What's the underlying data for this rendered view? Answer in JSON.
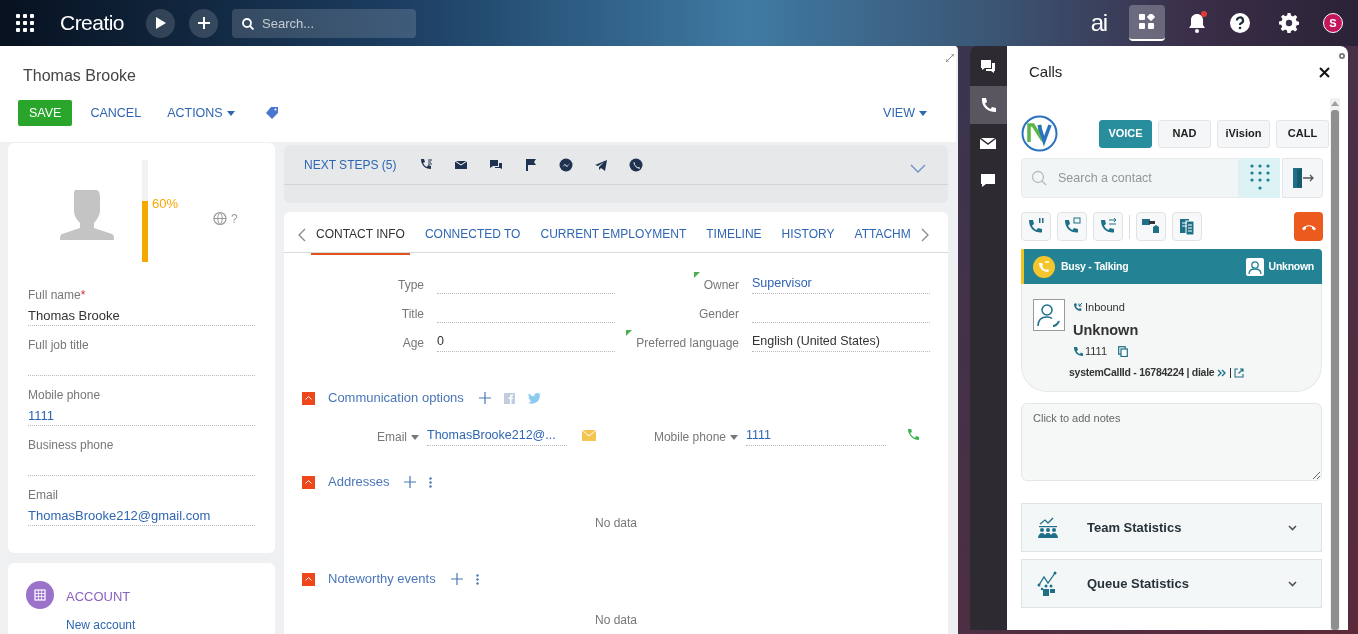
{
  "top_bar": {
    "logo": "Creatio",
    "search_placeholder": "Search...",
    "ai_label": "ai",
    "avatar_letter": "S",
    "has_notification": true
  },
  "record": {
    "title": "Thomas Brooke",
    "save": "SAVE",
    "cancel": "CANCEL",
    "actions": "ACTIONS",
    "view": "VIEW"
  },
  "profile": {
    "completeness": {
      "level": 0.6,
      "reading": "60%"
    },
    "timezone": "?",
    "fields": [
      {
        "label": "Full name",
        "value": "Thomas Brooke",
        "required_mark": "*",
        "kind": "text"
      },
      {
        "label": "Full job title"
      },
      {
        "label": "Mobile phone",
        "value": "1111",
        "kind": "link"
      },
      {
        "label": "Business phone"
      },
      {
        "label": "Email",
        "value": "ThomasBrooke212@gmail.com",
        "kind": "link"
      }
    ]
  },
  "account": {
    "title": "ACCOUNT",
    "link": "New account"
  },
  "next_steps": {
    "label": "NEXT STEPS (5)"
  },
  "tabs": [
    {
      "label": "CONTACT INFO",
      "selected": true
    },
    {
      "label": "CONNECTED TO",
      "selected": false
    },
    {
      "label": "CURRENT EMPLOYMENT",
      "selected": false
    },
    {
      "label": "TIMELINE",
      "selected": false
    },
    {
      "label": "HISTORY",
      "selected": false
    },
    {
      "label": "ATTACHM",
      "selected": false
    }
  ],
  "contact_fields": {
    "left": [
      {
        "label": "Type",
        "flagged": false
      },
      {
        "label": "Title",
        "flagged": false
      },
      {
        "label": "Age",
        "value": "0",
        "flagged": false
      }
    ],
    "right": [
      {
        "label": "Owner",
        "value": "Supervisor",
        "kind": "link",
        "flagged": true
      },
      {
        "label": "Gender",
        "flagged": false
      },
      {
        "label": "Preferred language",
        "value": "English (United States)",
        "kind": "text",
        "flagged": true
      }
    ]
  },
  "sections": [
    {
      "title": "Communication options",
      "expanded": true,
      "kind": "communication",
      "rows": [
        {
          "type_label": "Email",
          "value": "ThomasBrooke212@...",
          "kind": "email"
        },
        {
          "type_label": "Mobile phone",
          "value": "1111",
          "kind": "phone"
        }
      ]
    },
    {
      "title": "Addresses",
      "expanded": true,
      "kind": "list",
      "empty_text": "No data"
    },
    {
      "title": "Noteworthy events",
      "expanded": true,
      "kind": "list",
      "empty_text": "No data"
    }
  ],
  "calls_panel": {
    "title": "Calls",
    "side_tabs": [
      {
        "kind": "chat",
        "selected": false
      },
      {
        "kind": "phone",
        "selected": true
      },
      {
        "kind": "mail",
        "selected": false
      },
      {
        "kind": "message",
        "selected": false
      }
    ],
    "channels": [
      {
        "label": "VOICE",
        "selected": true
      },
      {
        "label": "NAD",
        "selected": false
      },
      {
        "label": "iVision",
        "selected": false
      },
      {
        "label": "CALL",
        "selected": false
      }
    ],
    "search_placeholder": "Search a contact",
    "status": {
      "label": "Busy - Talking",
      "agent": "Unknown"
    },
    "call": {
      "direction": "Inbound",
      "name": "Unknown",
      "number": "1111",
      "info": "systemCallId - 16784224 | diale"
    },
    "notes_placeholder": "Click to add notes",
    "stats": [
      {
        "label": "Team Statistics",
        "kind": "team",
        "expanded": false
      },
      {
        "label": "Queue Statistics",
        "kind": "queue",
        "expanded": false
      }
    ]
  }
}
